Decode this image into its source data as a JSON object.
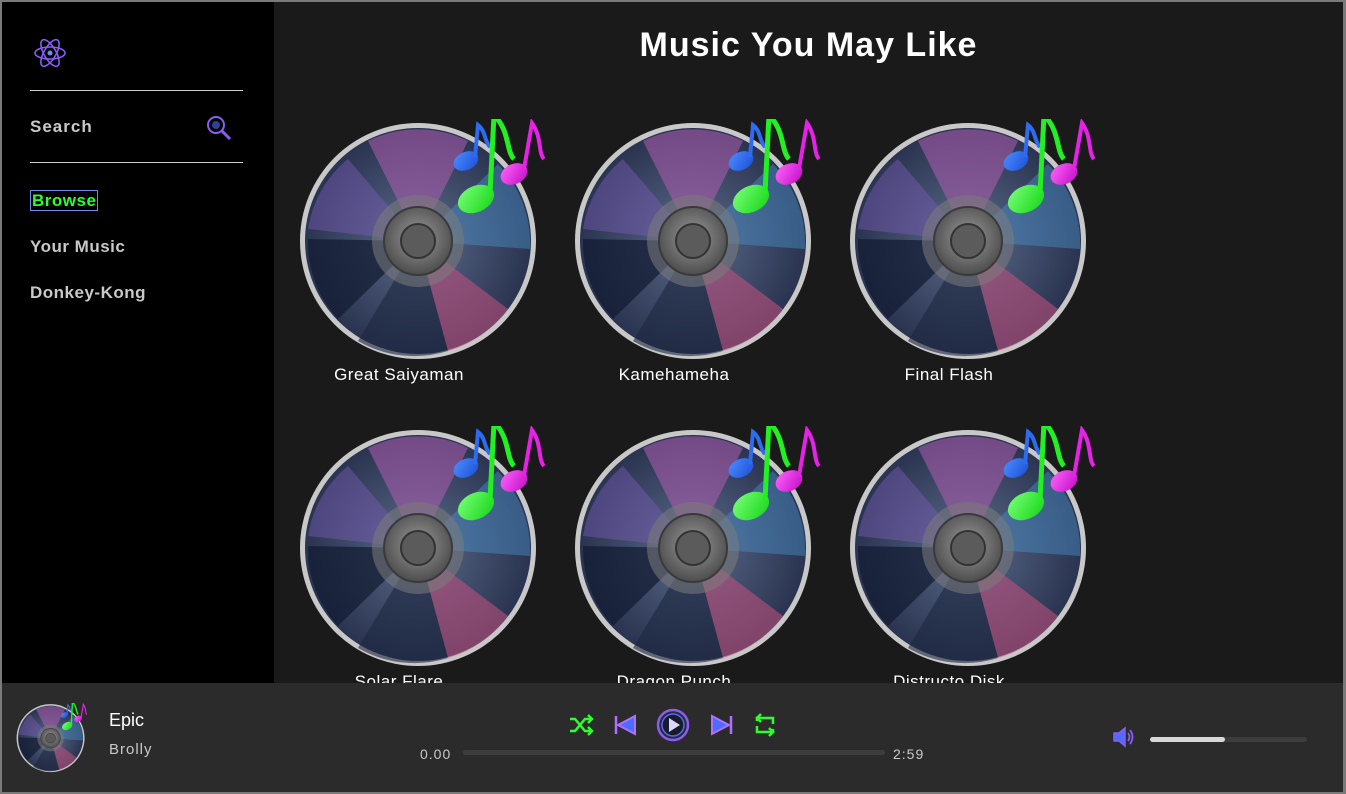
{
  "sidebar": {
    "logo_icon": "atom-icon",
    "search_label": "Search",
    "search_icon": "magnifier-icon",
    "nav": [
      {
        "label": "Browse",
        "active": true
      },
      {
        "label": "Your Music",
        "active": false
      },
      {
        "label": "Donkey-Kong",
        "active": false
      }
    ]
  },
  "main": {
    "title": "Music You May Like",
    "albums": [
      {
        "title": "Great Saiyaman"
      },
      {
        "title": "Kamehameha"
      },
      {
        "title": "Final Flash"
      },
      {
        "title": "Solar Flare"
      },
      {
        "title": "Dragon Punch"
      },
      {
        "title": "Distructo Disk"
      }
    ]
  },
  "player": {
    "track_title": "Epic",
    "track_artist": "Brolly",
    "elapsed": "0.00",
    "duration": "2:59",
    "progress": 0,
    "volume": 0.48,
    "controls": [
      "shuffle-icon",
      "previous-icon",
      "play-icon",
      "next-icon",
      "repeat-icon"
    ],
    "volume_icon": "speaker-icon"
  },
  "colors": {
    "accent_green": "#2cff2c",
    "accent_purple": "#8a5cf5",
    "sidebar_bg": "#000000",
    "main_bg": "#1a1a1a",
    "player_bg": "#2b2b2b"
  }
}
